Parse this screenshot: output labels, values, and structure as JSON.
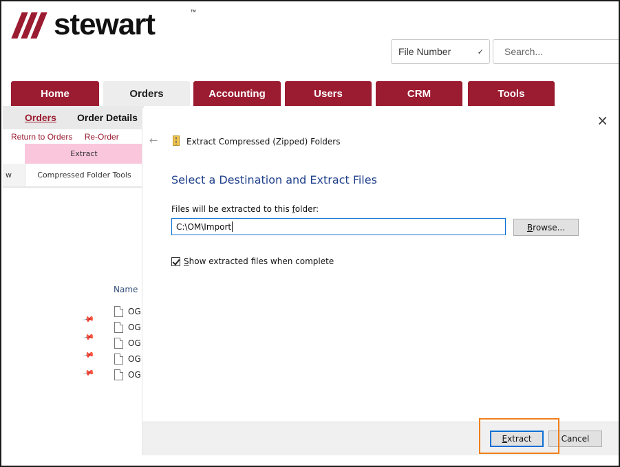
{
  "brand": {
    "name": "stewart",
    "tm": "™",
    "accent": "#9b1b30"
  },
  "search": {
    "type_selected": "File Number",
    "placeholder": "Search..."
  },
  "tabs": [
    {
      "label": "Home"
    },
    {
      "label": "Orders"
    },
    {
      "label": "Accounting"
    },
    {
      "label": "Users"
    },
    {
      "label": "CRM"
    },
    {
      "label": "Tools"
    }
  ],
  "subnav": {
    "orders": "Orders",
    "order_details": "Order Details"
  },
  "crumbs": {
    "return": "Return to Orders",
    "re_order": "Re-Order"
  },
  "ribbon": {
    "extract": "Extract",
    "tools": "Compressed Folder Tools",
    "left": "w"
  },
  "explorer": {
    "name_header": "Name",
    "files": [
      "OG",
      "OG",
      "OG",
      "OG",
      "OG"
    ]
  },
  "dialog": {
    "close": "×",
    "back": "←",
    "title": "Extract Compressed (Zipped) Folders",
    "heading": "Select a Destination and Extract Files",
    "folder_label": {
      "pre": "Files will be extracted to this ",
      "accel": "f",
      "post": "older:"
    },
    "path_value": "C:\\OM\\Import",
    "browse": {
      "accel": "B",
      "rest": "rowse..."
    },
    "show_files": {
      "accel": "S",
      "rest": "how extracted files when complete",
      "checked": true
    },
    "extract": {
      "accel": "E",
      "rest": "xtract"
    },
    "cancel": "Cancel"
  },
  "colors": {
    "highlight": "#ef7f1a",
    "dialog_heading": "#1e3f8a"
  }
}
